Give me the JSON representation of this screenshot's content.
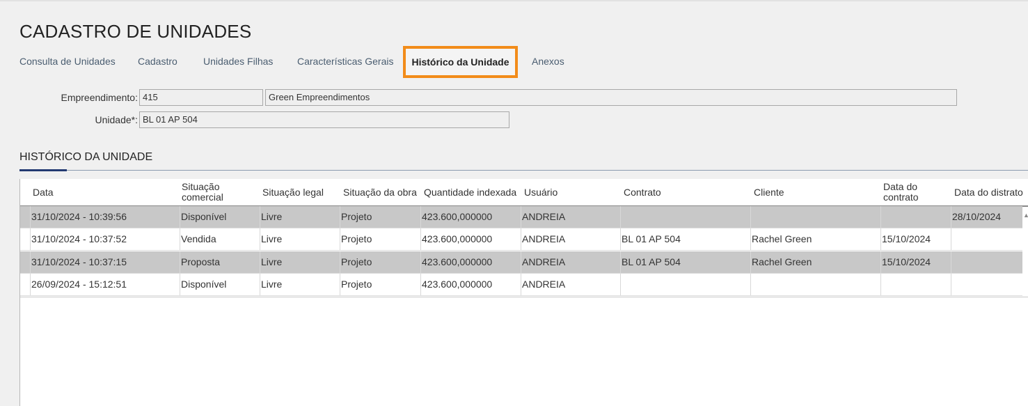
{
  "page": {
    "title": "CADASTRO DE UNIDADES"
  },
  "tabs": [
    {
      "label": "Consulta de Unidades"
    },
    {
      "label": "Cadastro"
    },
    {
      "label": "Unidades Filhas"
    },
    {
      "label": "Características Gerais"
    },
    {
      "label": "Histórico da Unidade",
      "active": true
    },
    {
      "label": "Anexos"
    }
  ],
  "form": {
    "empreendimento_label": "Empreendimento:",
    "empreendimento_code": "415",
    "empreendimento_name": "Green Empreendimentos",
    "unidade_label": "Unidade*:",
    "unidade_value": "BL 01 AP 504"
  },
  "section": {
    "title": "HISTÓRICO DA UNIDADE"
  },
  "table": {
    "columns": [
      "Data",
      "Situação comercial",
      "Situação legal",
      "Situação da obra",
      "Quantidade indexada",
      "Usuário",
      "Contrato",
      "Cliente",
      "Data do contrato",
      "Data do distrato"
    ],
    "rows": [
      [
        "31/10/2024 -  10:39:56",
        "Disponível",
        "Livre",
        "Projeto",
        "423.600,000000",
        "ANDREIA",
        "",
        "",
        "",
        "28/10/2024"
      ],
      [
        "31/10/2024 -  10:37:52",
        "Vendida",
        "Livre",
        "Projeto",
        "423.600,000000",
        "ANDREIA",
        "BL 01 AP 504",
        "Rachel Green",
        "15/10/2024",
        ""
      ],
      [
        "31/10/2024 -  10:37:15",
        "Proposta",
        "Livre",
        "Projeto",
        "423.600,000000",
        "ANDREIA",
        "BL 01 AP 504",
        "Rachel Green",
        "15/10/2024",
        ""
      ],
      [
        "26/09/2024 -  15:12:51",
        "Disponível",
        "Livre",
        "Projeto",
        "423.600,000000",
        "ANDREIA",
        "",
        "",
        "",
        ""
      ]
    ]
  },
  "colors": {
    "accent": "#f28c1a",
    "section_underline": "#233a72",
    "row_shaded": "#c8c8c8"
  }
}
